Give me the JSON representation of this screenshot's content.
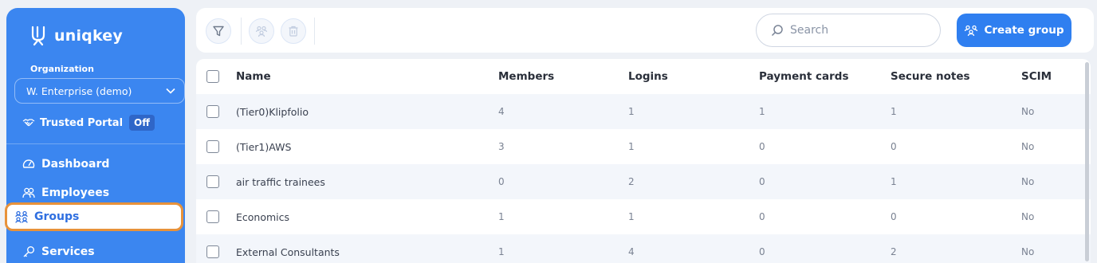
{
  "sidebar": {
    "brand": "uniqkey",
    "org_label": "Organization",
    "org_value": "W. Enterprise (demo)",
    "portal_label": "Trusted Portal",
    "portal_status": "Off",
    "nav": {
      "dashboard": "Dashboard",
      "employees": "Employees",
      "groups": "Groups",
      "services": "Services"
    },
    "active_item": "Groups",
    "colors": {
      "bg": "#3b86f0",
      "active_outline": "#e8923a"
    }
  },
  "toolbar": {
    "icons": [
      "filter-icon",
      "group-members-icon",
      "trash-icon"
    ],
    "search_placeholder": "Search",
    "create_label": "Create group"
  },
  "table": {
    "headers": {
      "name": "Name",
      "members": "Members",
      "logins": "Logins",
      "payment_cards": "Payment cards",
      "secure_notes": "Secure notes",
      "scim": "SCIM"
    },
    "rows": [
      {
        "name": "(Tier0)Klipfolio",
        "members": "4",
        "logins": "1",
        "payment_cards": "1",
        "secure_notes": "1",
        "scim": "No"
      },
      {
        "name": "(Tier1)AWS",
        "members": "3",
        "logins": "1",
        "payment_cards": "0",
        "secure_notes": "0",
        "scim": "No"
      },
      {
        "name": "air traffic trainees",
        "members": "0",
        "logins": "2",
        "payment_cards": "0",
        "secure_notes": "1",
        "scim": "No"
      },
      {
        "name": "Economics",
        "members": "1",
        "logins": "1",
        "payment_cards": "0",
        "secure_notes": "0",
        "scim": "No"
      },
      {
        "name": "External Consultants",
        "members": "1",
        "logins": "4",
        "payment_cards": "0",
        "secure_notes": "2",
        "scim": "No"
      }
    ]
  }
}
